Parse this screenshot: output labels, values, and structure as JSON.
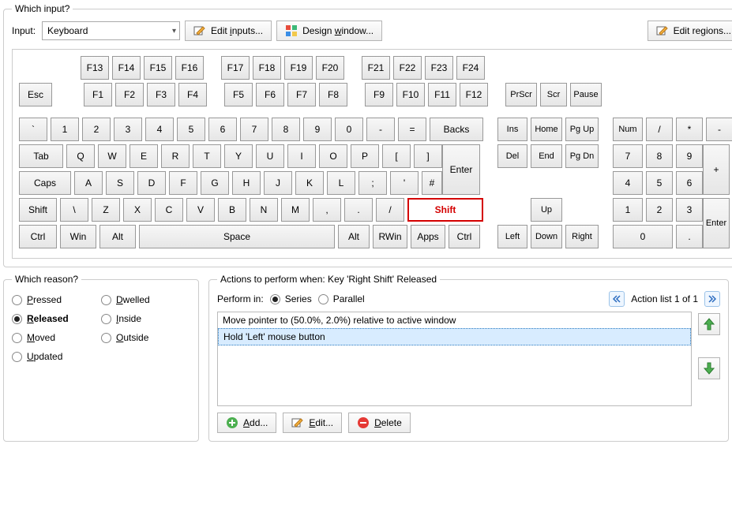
{
  "which_input": {
    "legend": "Which input?",
    "input_label": "Input:",
    "dropdown_value": "Keyboard",
    "edit_inputs": "Edit inputs...",
    "design_window": "Design window...",
    "edit_regions": "Edit regions..."
  },
  "keyboard": {
    "frow_top": [
      "F13",
      "F14",
      "F15",
      "F16",
      "F17",
      "F18",
      "F19",
      "F20",
      "F21",
      "F22",
      "F23",
      "F24"
    ],
    "frow_bot": [
      "F1",
      "F2",
      "F3",
      "F4",
      "F5",
      "F6",
      "F7",
      "F8",
      "F9",
      "F10",
      "F11",
      "F12"
    ],
    "esc": "Esc",
    "prscr": "PrScr",
    "scr": "Scr",
    "pause": "Pause",
    "row_num": [
      "`",
      "1",
      "2",
      "3",
      "4",
      "5",
      "6",
      "7",
      "8",
      "9",
      "0",
      "-",
      "=",
      "Backs"
    ],
    "row_q": [
      "Tab",
      "Q",
      "W",
      "E",
      "R",
      "T",
      "Y",
      "U",
      "I",
      "O",
      "P",
      "[",
      "]"
    ],
    "enter": "Enter",
    "row_a": [
      "Caps",
      "A",
      "S",
      "D",
      "F",
      "G",
      "H",
      "J",
      "K",
      "L",
      ";",
      "'",
      "#"
    ],
    "row_z": [
      "Shift",
      "\\",
      "Z",
      "X",
      "C",
      "V",
      "B",
      "N",
      "M",
      ",",
      ".",
      "/",
      "Shift"
    ],
    "row_ctrl": [
      "Ctrl",
      "Win",
      "Alt",
      "Space",
      "Alt",
      "RWin",
      "Apps",
      "Ctrl"
    ],
    "nav1": [
      "Ins",
      "Home",
      "Pg Up"
    ],
    "nav2": [
      "Del",
      "End",
      "Pg Dn"
    ],
    "up": "Up",
    "left": "Left",
    "down": "Down",
    "right": "Right",
    "numtop": [
      "Num",
      "/",
      "*",
      "-"
    ],
    "num789": [
      "7",
      "8",
      "9"
    ],
    "plus": "+",
    "num456": [
      "4",
      "5",
      "6"
    ],
    "num123": [
      "1",
      "2",
      "3"
    ],
    "enter2": "Enter",
    "num0": "0",
    "numdot": "."
  },
  "reason": {
    "legend": "Which reason?",
    "options": [
      {
        "label": "Pressed",
        "accel": "P",
        "checked": false
      },
      {
        "label": "Dwelled",
        "accel": "D",
        "checked": false
      },
      {
        "label": "Released",
        "accel": "R",
        "checked": true
      },
      {
        "label": "Inside",
        "accel": "I",
        "checked": false
      },
      {
        "label": "Moved",
        "accel": "M",
        "checked": false
      },
      {
        "label": "Outside",
        "accel": "O",
        "checked": false
      },
      {
        "label": "Updated",
        "accel": "U",
        "checked": false
      }
    ]
  },
  "actions": {
    "legend": "Actions to perform when: Key 'Right Shift' Released",
    "perform_label": "Perform in:",
    "series": "Series",
    "parallel": "Parallel",
    "perform_mode": "series",
    "list_counter": "Action list 1 of 1",
    "items": [
      {
        "text": "Move pointer to (50.0%, 2.0%) relative to active window",
        "selected": false
      },
      {
        "text": "Hold 'Left' mouse button",
        "selected": true
      }
    ],
    "add": "Add...",
    "edit": "Edit...",
    "delete": "Delete"
  }
}
